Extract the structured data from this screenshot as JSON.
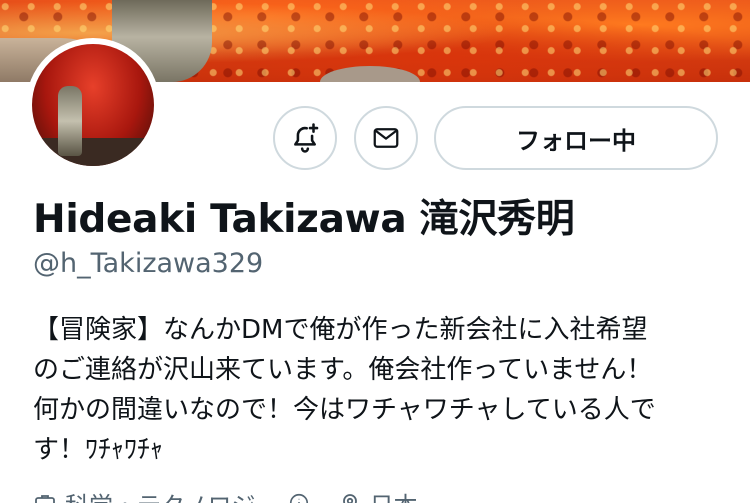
{
  "profile": {
    "name": "Hideaki Takizawa 滝沢秀明",
    "handle": "@h_Takizawa329",
    "follow_label": "フォロー中",
    "bio": [
      "【冒険家】なんかDMで俺が作った新会社に入社希望",
      "のご連絡が沢山来ています。俺会社作っていません！",
      "何かの間違いなので！今はワチャワチャしている人で",
      "す！ﾜﾁｬﾜﾁｬ"
    ],
    "meta": {
      "category": "科学・テクノロジー",
      "location": "日本"
    }
  },
  "icons": {
    "notify": "bell-plus-icon",
    "message": "envelope-icon",
    "category": "briefcase-icon",
    "info": "info-icon",
    "location": "location-pin-icon"
  },
  "colors": {
    "text": "#0f1419",
    "secondary": "#536471",
    "border": "#cfd9de"
  }
}
